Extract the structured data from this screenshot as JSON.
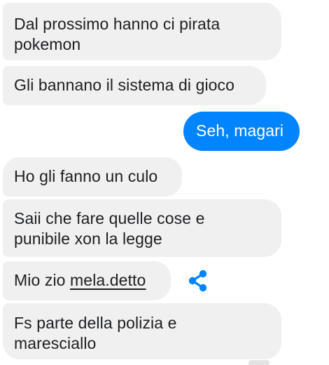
{
  "conversation": {
    "messages": [
      {
        "sender": "them",
        "line1": "Dal prossimo hanno ci pirata",
        "line2": "pokemon"
      },
      {
        "sender": "them",
        "text": "Gli bannano il sistema di gioco"
      },
      {
        "sender": "me",
        "text": "Seh, magari"
      },
      {
        "sender": "them",
        "text": "Ho gli fanno un culo"
      },
      {
        "sender": "them",
        "line1": "Saii che fare quelle cose e",
        "line2": "punibile xon la legge"
      },
      {
        "sender": "them",
        "prefix": "Mio zio ",
        "link": "mela.detto"
      },
      {
        "sender": "them",
        "line1": "Fs parte della polizia e",
        "line2": "maresciallo"
      }
    ]
  },
  "icons": {
    "share": "share-icon"
  },
  "colors": {
    "incoming_bubble": "#f0f0f0",
    "outgoing_bubble": "#0084ff",
    "accent": "#0084ff"
  }
}
